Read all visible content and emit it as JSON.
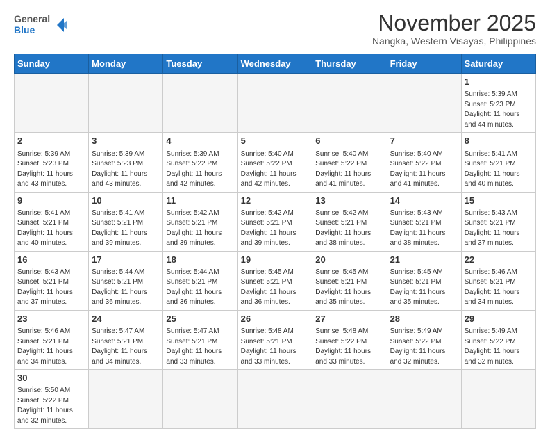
{
  "logo": {
    "general": "General",
    "blue": "Blue"
  },
  "title": "November 2025",
  "location": "Nangka, Western Visayas, Philippines",
  "weekdays": [
    "Sunday",
    "Monday",
    "Tuesday",
    "Wednesday",
    "Thursday",
    "Friday",
    "Saturday"
  ],
  "weeks": [
    [
      {
        "day": "",
        "info": ""
      },
      {
        "day": "",
        "info": ""
      },
      {
        "day": "",
        "info": ""
      },
      {
        "day": "",
        "info": ""
      },
      {
        "day": "",
        "info": ""
      },
      {
        "day": "",
        "info": ""
      },
      {
        "day": "1",
        "info": "Sunrise: 5:39 AM\nSunset: 5:23 PM\nDaylight: 11 hours and 44 minutes."
      }
    ],
    [
      {
        "day": "2",
        "info": "Sunrise: 5:39 AM\nSunset: 5:23 PM\nDaylight: 11 hours and 43 minutes."
      },
      {
        "day": "3",
        "info": "Sunrise: 5:39 AM\nSunset: 5:23 PM\nDaylight: 11 hours and 43 minutes."
      },
      {
        "day": "4",
        "info": "Sunrise: 5:39 AM\nSunset: 5:22 PM\nDaylight: 11 hours and 42 minutes."
      },
      {
        "day": "5",
        "info": "Sunrise: 5:40 AM\nSunset: 5:22 PM\nDaylight: 11 hours and 42 minutes."
      },
      {
        "day": "6",
        "info": "Sunrise: 5:40 AM\nSunset: 5:22 PM\nDaylight: 11 hours and 41 minutes."
      },
      {
        "day": "7",
        "info": "Sunrise: 5:40 AM\nSunset: 5:22 PM\nDaylight: 11 hours and 41 minutes."
      },
      {
        "day": "8",
        "info": "Sunrise: 5:41 AM\nSunset: 5:21 PM\nDaylight: 11 hours and 40 minutes."
      }
    ],
    [
      {
        "day": "9",
        "info": "Sunrise: 5:41 AM\nSunset: 5:21 PM\nDaylight: 11 hours and 40 minutes."
      },
      {
        "day": "10",
        "info": "Sunrise: 5:41 AM\nSunset: 5:21 PM\nDaylight: 11 hours and 39 minutes."
      },
      {
        "day": "11",
        "info": "Sunrise: 5:42 AM\nSunset: 5:21 PM\nDaylight: 11 hours and 39 minutes."
      },
      {
        "day": "12",
        "info": "Sunrise: 5:42 AM\nSunset: 5:21 PM\nDaylight: 11 hours and 39 minutes."
      },
      {
        "day": "13",
        "info": "Sunrise: 5:42 AM\nSunset: 5:21 PM\nDaylight: 11 hours and 38 minutes."
      },
      {
        "day": "14",
        "info": "Sunrise: 5:43 AM\nSunset: 5:21 PM\nDaylight: 11 hours and 38 minutes."
      },
      {
        "day": "15",
        "info": "Sunrise: 5:43 AM\nSunset: 5:21 PM\nDaylight: 11 hours and 37 minutes."
      }
    ],
    [
      {
        "day": "16",
        "info": "Sunrise: 5:43 AM\nSunset: 5:21 PM\nDaylight: 11 hours and 37 minutes."
      },
      {
        "day": "17",
        "info": "Sunrise: 5:44 AM\nSunset: 5:21 PM\nDaylight: 11 hours and 36 minutes."
      },
      {
        "day": "18",
        "info": "Sunrise: 5:44 AM\nSunset: 5:21 PM\nDaylight: 11 hours and 36 minutes."
      },
      {
        "day": "19",
        "info": "Sunrise: 5:45 AM\nSunset: 5:21 PM\nDaylight: 11 hours and 36 minutes."
      },
      {
        "day": "20",
        "info": "Sunrise: 5:45 AM\nSunset: 5:21 PM\nDaylight: 11 hours and 35 minutes."
      },
      {
        "day": "21",
        "info": "Sunrise: 5:45 AM\nSunset: 5:21 PM\nDaylight: 11 hours and 35 minutes."
      },
      {
        "day": "22",
        "info": "Sunrise: 5:46 AM\nSunset: 5:21 PM\nDaylight: 11 hours and 34 minutes."
      }
    ],
    [
      {
        "day": "23",
        "info": "Sunrise: 5:46 AM\nSunset: 5:21 PM\nDaylight: 11 hours and 34 minutes."
      },
      {
        "day": "24",
        "info": "Sunrise: 5:47 AM\nSunset: 5:21 PM\nDaylight: 11 hours and 34 minutes."
      },
      {
        "day": "25",
        "info": "Sunrise: 5:47 AM\nSunset: 5:21 PM\nDaylight: 11 hours and 33 minutes."
      },
      {
        "day": "26",
        "info": "Sunrise: 5:48 AM\nSunset: 5:21 PM\nDaylight: 11 hours and 33 minutes."
      },
      {
        "day": "27",
        "info": "Sunrise: 5:48 AM\nSunset: 5:22 PM\nDaylight: 11 hours and 33 minutes."
      },
      {
        "day": "28",
        "info": "Sunrise: 5:49 AM\nSunset: 5:22 PM\nDaylight: 11 hours and 32 minutes."
      },
      {
        "day": "29",
        "info": "Sunrise: 5:49 AM\nSunset: 5:22 PM\nDaylight: 11 hours and 32 minutes."
      }
    ],
    [
      {
        "day": "30",
        "info": "Sunrise: 5:50 AM\nSunset: 5:22 PM\nDaylight: 11 hours and 32 minutes."
      },
      {
        "day": "",
        "info": ""
      },
      {
        "day": "",
        "info": ""
      },
      {
        "day": "",
        "info": ""
      },
      {
        "day": "",
        "info": ""
      },
      {
        "day": "",
        "info": ""
      },
      {
        "day": "",
        "info": ""
      }
    ]
  ]
}
